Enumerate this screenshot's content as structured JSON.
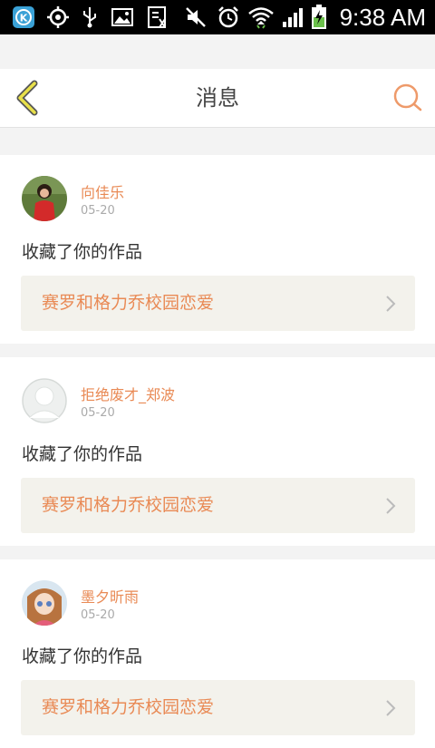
{
  "status_bar": {
    "time": "9:38 AM",
    "icons": [
      "k-app-icon",
      "location-icon",
      "usb-icon",
      "image-icon",
      "download-icon",
      "mute-icon",
      "alarm-icon",
      "wifi-icon",
      "signal-icon",
      "battery-charging-icon"
    ]
  },
  "header": {
    "title": "消息",
    "back_icon": "chevron-left-icon",
    "search_icon": "search-icon"
  },
  "colors": {
    "accent": "#e98a55",
    "back_chevron": "#e8e04a",
    "work_bg": "#f3f2ec",
    "page_bg": "#f3f3f3"
  },
  "messages": [
    {
      "username": "向佳乐",
      "date": "05-20",
      "action": "收藏了你的作品",
      "work_title": "赛罗和格力乔校园恋爱"
    },
    {
      "username": "拒绝废才_郑波",
      "date": "05-20",
      "action": "收藏了你的作品",
      "work_title": "赛罗和格力乔校园恋爱"
    },
    {
      "username": "墨夕昕雨",
      "date": "05-20",
      "action": "收藏了你的作品",
      "work_title": "赛罗和格力乔校园恋爱"
    }
  ]
}
